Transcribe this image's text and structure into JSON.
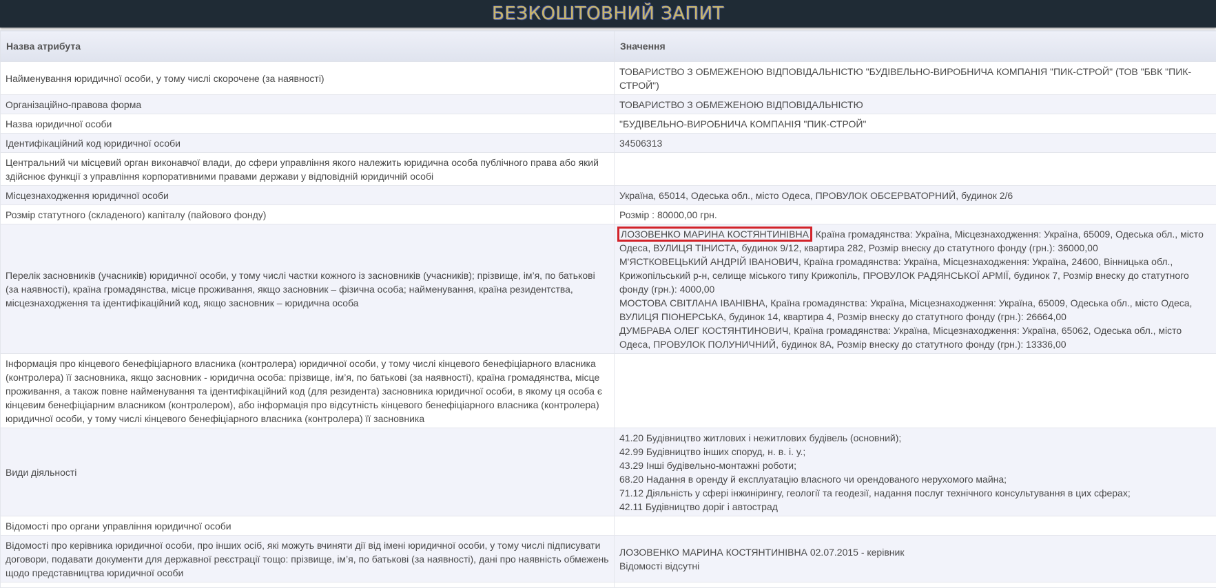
{
  "banner": {
    "title": "БЕЗКОШТОВНИЙ ЗАПИТ"
  },
  "table": {
    "headers": {
      "attribute": "Назва атрибута",
      "value": "Значення"
    },
    "rows": [
      {
        "attr": "Найменування юридичної особи, у тому числі скорочене (за наявності)",
        "value": [
          "ТОВАРИСТВО З ОБМЕЖЕНОЮ ВІДПОВІДАЛЬНІСТЮ \"БУДІВЕЛЬНО-ВИРОБНИЧА КОМПАНІЯ \"ПИК-СТРОЙ\" (ТОВ \"БВК \"ПИК-СТРОЙ\")"
        ]
      },
      {
        "attr": "Організаційно-правова форма",
        "value": [
          "ТОВАРИСТВО З ОБМЕЖЕНОЮ ВІДПОВІДАЛЬНІСТЮ"
        ]
      },
      {
        "attr": "Назва юридичної особи",
        "value": [
          "\"БУДІВЕЛЬНО-ВИРОБНИЧА КОМПАНІЯ \"ПИК-СТРОЙ\""
        ]
      },
      {
        "attr": "Ідентифікаційний код юридичної особи",
        "value": [
          "34506313"
        ]
      },
      {
        "attr": "Центральний чи місцевий орган виконавчої влади, до сфери управління якого належить юридична особа публічного права або який здійснює функції з управління корпоративними правами держави у відповідній юридичній особі",
        "value": []
      },
      {
        "attr": "Місцезнаходження юридичної особи",
        "value": [
          "Україна, 65014, Одеська обл., місто Одеса, ПРОВУЛОК ОБСЕРВАТОРНИЙ, будинок 2/6"
        ]
      },
      {
        "attr": "Розмір статутного (складеного) капіталу (пайового фонду)",
        "value": [
          "Розмір : 80000,00 грн."
        ]
      },
      {
        "attr": "Перелік засновників (учасників) юридичної особи, у тому числі частки кожного із засновників (учасників); прізвище, ім’я, по батькові (за наявності), країна громадянства, місце проживання, якщо засновник – фізична особа; найменування, країна резидентства, місцезнаходження та ідентифікаційний код, якщо засновник – юридична особа",
        "founders": [
          {
            "name": "ЛОЗОВЕНКО МАРИНА КОСТЯНТИНІВНА",
            "details": ", Країна громадянства: Україна, Місцезнаходження: Україна, 65009, Одеська обл., місто Одеса, ВУЛИЦЯ ТІНИСТА, будинок 9/12, квартира 282, Розмір внеску до статутного фонду (грн.): 36000,00"
          },
          {
            "name": "М'ЯСТКОВЕЦЬКИЙ АНДРІЙ ІВАНОВИЧ",
            "details": ", Країна громадянства: Україна, Місцезнаходження: Україна, 24600, Вінницька обл., Крижопільський р-н, селище міського типу Крижопіль, ПРОВУЛОК РАДЯНСЬКОЇ АРМІЇ, будинок 7, Розмір внеску до статутного фонду (грн.): 4000,00"
          },
          {
            "name": "МОСТОВА СВІТЛАНА ІВАНІВНА",
            "details": ", Країна громадянства: Україна, Місцезнаходження: Україна, 65009, Одеська обл., місто Одеса, ВУЛИЦЯ ПІОНЕРСЬКА, будинок 14, квартира 4, Розмір внеску до статутного фонду (грн.): 26664,00"
          },
          {
            "name": "ДУМБРАВА ОЛЕГ КОСТЯНТИНОВИЧ",
            "details": ", Країна громадянства: Україна, Місцезнаходження: Україна, 65062, Одеська обл., місто Одеса, ПРОВУЛОК ПОЛУНИЧНИЙ, будинок 8А, Розмір внеску до статутного фонду (грн.): 13336,00"
          }
        ]
      },
      {
        "attr": "Інформація про кінцевого бенефіціарного власника (контролера) юридичної особи, у тому числі кінцевого бенефіціарного власника (контролера) її засновника, якщо засновник - юридична особа: прізвище, ім’я, по батькові (за наявності), країна громадянства, місце проживання, а також повне найменування та ідентифікаційний код (для резидента) засновника юридичної особи, в якому ця особа є кінцевим бенефіціарним власником (контролером), або інформація про відсутність кінцевого бенефіціарного власника (контролера) юридичної особи, у тому числі кінцевого бенефіціарного власника (контролера) її засновника",
        "value": []
      },
      {
        "attr": "Види діяльності",
        "value": [
          "41.20 Будівництво житлових і нежитлових будівель (основний);",
          "42.99 Будівництво інших споруд, н. в. і. у.;",
          "43.29 Інші будівельно-монтажні роботи;",
          "68.20 Надання в оренду й експлуатацію власного чи орендованого нерухомого майна;",
          "71.12 Діяльність у сфері інжинірингу, геології та геодезії, надання послуг технічного консультування в цих сферах;",
          "42.11 Будівництво доріг і автострад"
        ]
      },
      {
        "attr": "Відомості про органи управління юридичної особи",
        "value": []
      },
      {
        "attr": "Відомості про керівника юридичної особи, про інших осіб, які можуть вчиняти дії від імені юридичної особи, у тому числі підписувати договори, подавати документи для державної реєстрації тощо: прізвище, ім’я, по батькові (за наявності), дані про наявність обмежень щодо представництва юридичної особи",
        "value": [
          "ЛОЗОВЕНКО МАРИНА КОСТЯНТИНІВНА 02.07.2015 - керівник",
          "Відомості відсутні"
        ]
      },
      {
        "attr": "",
        "value": []
      }
    ]
  }
}
